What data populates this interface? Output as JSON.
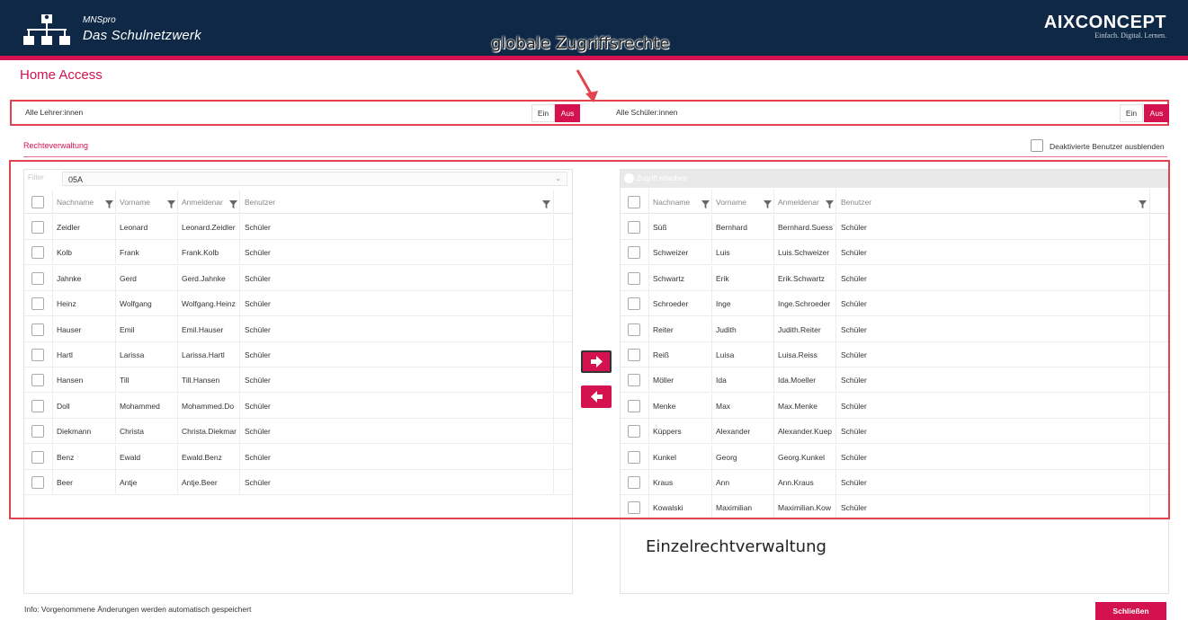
{
  "header": {
    "brand_small": "MNSpro",
    "brand_big": "Das Schulnetzwerk",
    "partner_logo": "AIXCONCEPT",
    "partner_tagline": "Einfach. Digital. Lernen.",
    "logo_icon": "network-tree-icon"
  },
  "annotations": {
    "global": "globale  Zugriffsrechte",
    "individual": "Einzelrechtverwaltung"
  },
  "page": {
    "title": "Home Access"
  },
  "global_rights": {
    "teachers_label": "Alle Lehrer:innen",
    "students_label": "Alle Schüler:innen",
    "on_label": "Ein",
    "off_label": "Aus"
  },
  "rights": {
    "tab_label": "Rechteverwaltung",
    "hide_disabled_label": "Deaktivierte Benutzer ausblenden"
  },
  "left_panel": {
    "toolbar_label": "Filter",
    "class_select": "05A",
    "columns": [
      "Nachname",
      "Vorname",
      "Anmeldenar",
      "Benutzer"
    ],
    "rows": [
      [
        "Zeidler",
        "Leonard",
        "Leonard.Zeidler",
        "Schüler"
      ],
      [
        "Kolb",
        "Frank",
        "Frank.Kolb",
        "Schüler"
      ],
      [
        "Jahnke",
        "Gerd",
        "Gerd.Jahnke",
        "Schüler"
      ],
      [
        "Heinz",
        "Wolfgang",
        "Wolfgang.Heinz",
        "Schüler"
      ],
      [
        "Hauser",
        "Emil",
        "Emil.Hauser",
        "Schüler"
      ],
      [
        "Hartl",
        "Larissa",
        "Larissa.Hartl",
        "Schüler"
      ],
      [
        "Hansen",
        "Till",
        "Till.Hansen",
        "Schüler"
      ],
      [
        "Doll",
        "Mohammed",
        "Mohammed.Do",
        "Schüler"
      ],
      [
        "Diekmann",
        "Christa",
        "Christa.Diekmar",
        "Schüler"
      ],
      [
        "Benz",
        "Ewald",
        "Ewald.Benz",
        "Schüler"
      ],
      [
        "Beer",
        "Antje",
        "Antje.Beer",
        "Schüler"
      ]
    ]
  },
  "right_panel": {
    "toolbar_label": "Zugriff erlauben",
    "columns": [
      "Nachname",
      "Vorname",
      "Anmeldenar",
      "Benutzer"
    ],
    "rows": [
      [
        "Süß",
        "Bernhard",
        "Bernhard.Suess",
        "Schüler"
      ],
      [
        "Schweizer",
        "Luis",
        "Luis.Schweizer",
        "Schüler"
      ],
      [
        "Schwartz",
        "Erik",
        "Erik.Schwartz",
        "Schüler"
      ],
      [
        "Schroeder",
        "Inge",
        "Inge.Schroeder",
        "Schüler"
      ],
      [
        "Reiter",
        "Judith",
        "Judith.Reiter",
        "Schüler"
      ],
      [
        "Reiß",
        "Luisa",
        "Luisa.Reiss",
        "Schüler"
      ],
      [
        "Möller",
        "Ida",
        "Ida.Moeller",
        "Schüler"
      ],
      [
        "Menke",
        "Max",
        "Max.Menke",
        "Schüler"
      ],
      [
        "Küppers",
        "Alexander",
        "Alexander.Kuep",
        "Schüler"
      ],
      [
        "Kunkel",
        "Georg",
        "Georg.Kunkel",
        "Schüler"
      ],
      [
        "Kraus",
        "Ann",
        "Ann.Kraus",
        "Schüler"
      ],
      [
        "Kowalski",
        "Maximilian",
        "Maximilian.Kow",
        "Schüler"
      ]
    ]
  },
  "move_buttons": {
    "right_icon": "arrow-right-icon",
    "left_icon": "arrow-left-icon"
  },
  "footer": {
    "info": "Info: Vorgenommene Änderungen werden automatisch gespeichert",
    "close_label": "Schließen"
  },
  "colors": {
    "accent": "#d3124f",
    "header_bg": "#0e2845",
    "annotation_box": "#e0454f"
  }
}
